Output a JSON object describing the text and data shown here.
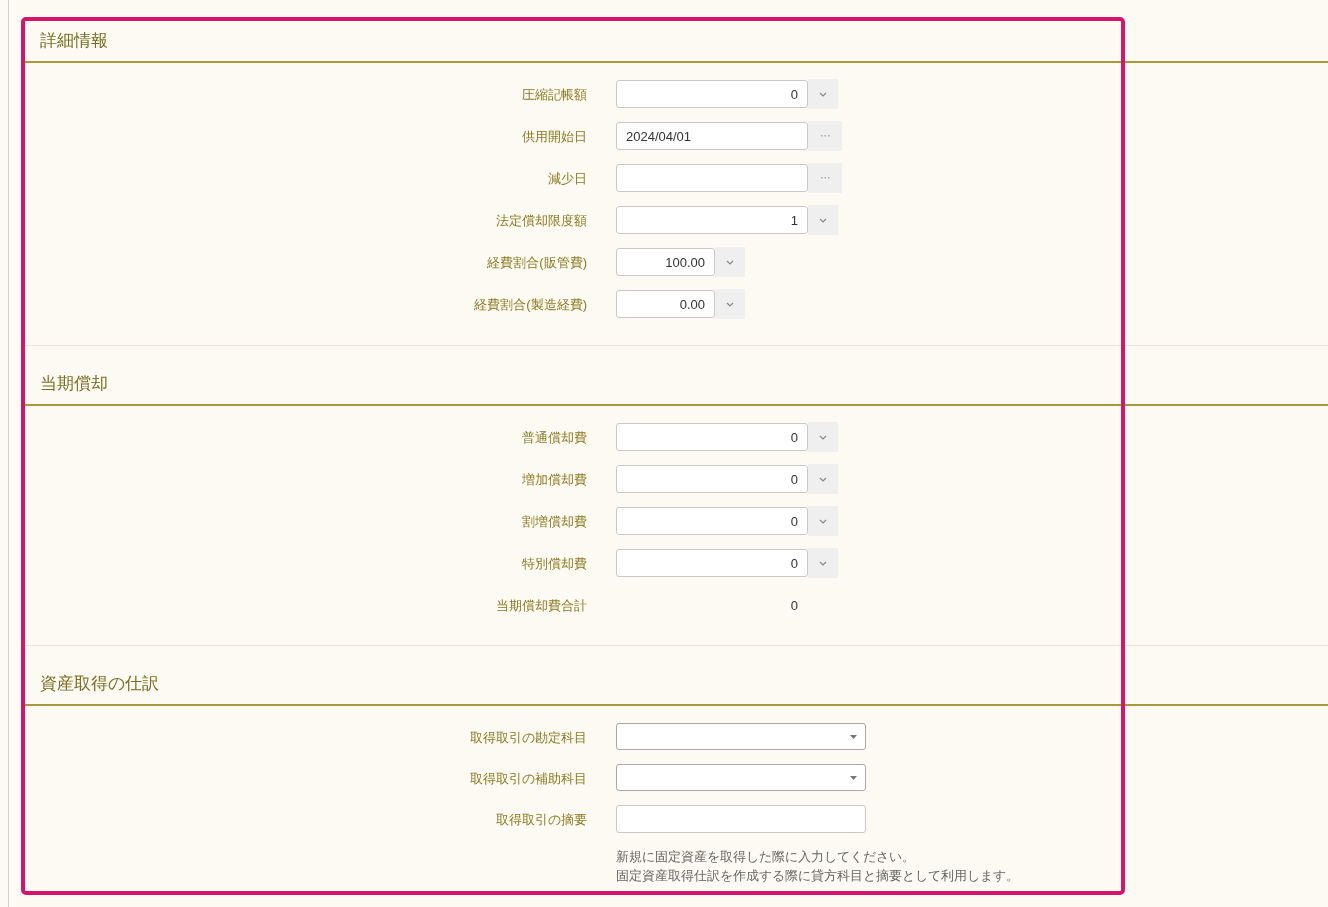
{
  "sections": [
    {
      "title": "詳細情報",
      "rows": [
        {
          "label": "圧縮記帳額",
          "kind": "amount",
          "value": "0"
        },
        {
          "label": "供用開始日",
          "kind": "date",
          "value": "2024/04/01"
        },
        {
          "label": "減少日",
          "kind": "date",
          "value": ""
        },
        {
          "label": "法定償却限度額",
          "kind": "amount",
          "value": "1"
        },
        {
          "label": "経費割合(販管費)",
          "kind": "ratio",
          "value": "100.00"
        },
        {
          "label": "経費割合(製造経費)",
          "kind": "ratio",
          "value": "0.00"
        }
      ]
    },
    {
      "title": "当期償却",
      "rows": [
        {
          "label": "普通償却費",
          "kind": "amount",
          "value": "0"
        },
        {
          "label": "増加償却費",
          "kind": "amount",
          "value": "0"
        },
        {
          "label": "割増償却費",
          "kind": "amount",
          "value": "0"
        },
        {
          "label": "特別償却費",
          "kind": "amount",
          "value": "0"
        },
        {
          "label": "当期償却費合計",
          "kind": "total",
          "value": "0"
        }
      ]
    },
    {
      "title": "資産取得の仕訳",
      "rows": [
        {
          "label": "取得取引の勘定科目",
          "kind": "select",
          "value": ""
        },
        {
          "label": "取得取引の補助科目",
          "kind": "select",
          "value": ""
        },
        {
          "label": "取得取引の摘要",
          "kind": "text",
          "value": ""
        }
      ],
      "note": [
        "新規に固定資産を取得した際に入力してください。",
        "固定資産取得仕訳を作成する際に貸方科目と摘要として利用します。"
      ]
    }
  ]
}
